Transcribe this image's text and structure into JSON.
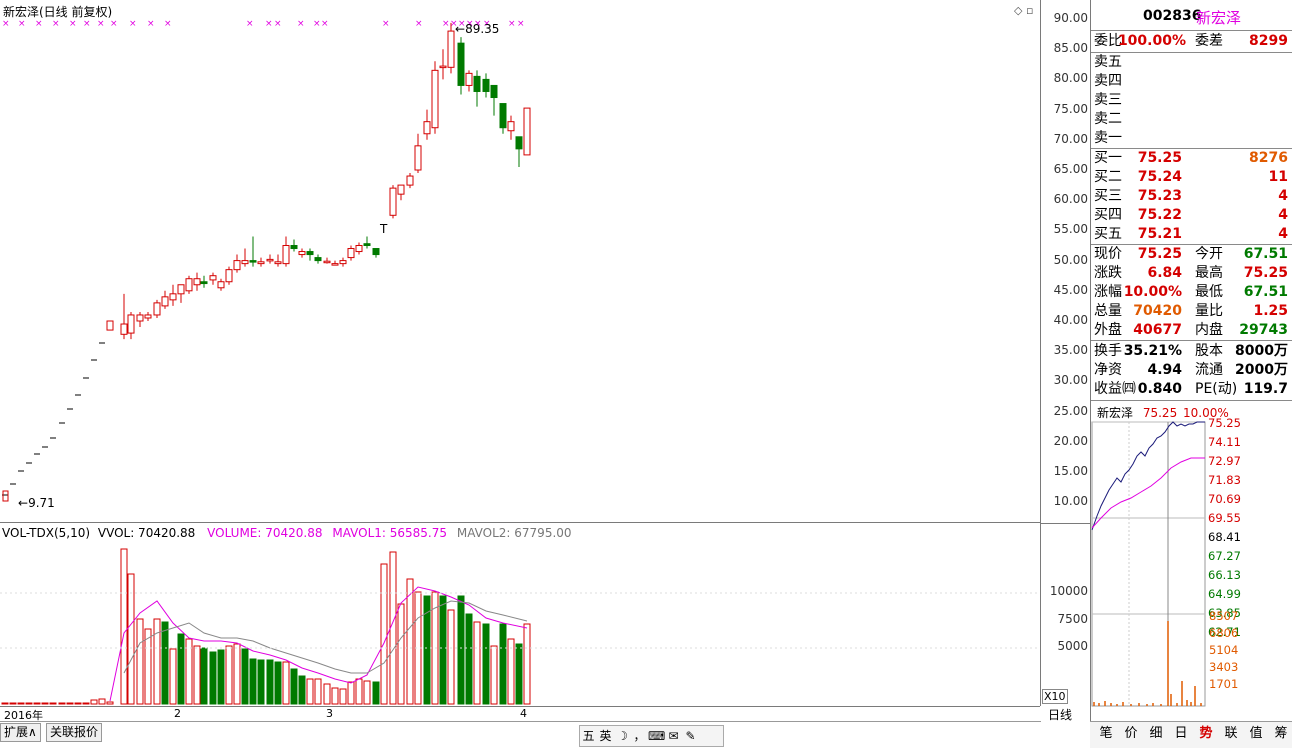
{
  "stock": {
    "code": "002836",
    "name": "新宏泽",
    "title": "新宏泽(日线 前复权)",
    "max_label": "89.35",
    "min_label": "9.71",
    "t_marker": "T",
    "year_label": "2016年"
  },
  "colors": {
    "up": "#d40000",
    "down": "#007a00",
    "ma": "#e000e0",
    "ma2": "#777777",
    "accent": "#2a2a9a"
  },
  "price_axis": [
    "90.00",
    "85.00",
    "80.00",
    "75.00",
    "70.00",
    "65.00",
    "60.00",
    "55.00",
    "50.00",
    "45.00",
    "40.00",
    "35.00",
    "30.00",
    "25.00",
    "20.00",
    "15.00",
    "10.00"
  ],
  "volume_axis": [
    "10000",
    "7500",
    "5000"
  ],
  "x_multiplier": "X10",
  "x_month_labels": [
    "2",
    "3",
    "4"
  ],
  "vol_header": {
    "name": "VOL-TDX(5,10)",
    "vvol": "VVOL: 70420.88",
    "volume": "VOLUME: 70420.88",
    "mavol1": "MAVOL1: 56585.75",
    "mavol2": "MAVOL2: 67795.00"
  },
  "quote": {
    "weibi_label": "委比",
    "weibi": "100.00%",
    "weicha_label": "委差",
    "weicha": "8299",
    "sell": [
      {
        "label": "卖五",
        "price": "",
        "vol": ""
      },
      {
        "label": "卖四",
        "price": "",
        "vol": ""
      },
      {
        "label": "卖三",
        "price": "",
        "vol": ""
      },
      {
        "label": "卖二",
        "price": "",
        "vol": ""
      },
      {
        "label": "卖一",
        "price": "",
        "vol": ""
      }
    ],
    "buy": [
      {
        "label": "买一",
        "price": "75.25",
        "vol": "8276"
      },
      {
        "label": "买二",
        "price": "75.24",
        "vol": "11"
      },
      {
        "label": "买三",
        "price": "75.23",
        "vol": "4"
      },
      {
        "label": "买四",
        "price": "75.22",
        "vol": "4"
      },
      {
        "label": "买五",
        "price": "75.21",
        "vol": "4"
      }
    ],
    "stats": [
      {
        "l1": "现价",
        "v1": "75.25",
        "c1": "red",
        "l2": "今开",
        "v2": "67.51",
        "c2": "green"
      },
      {
        "l1": "涨跌",
        "v1": "6.84",
        "c1": "red",
        "l2": "最高",
        "v2": "75.25",
        "c2": "red"
      },
      {
        "l1": "涨幅",
        "v1": "10.00%",
        "c1": "red",
        "l2": "最低",
        "v2": "67.51",
        "c2": "green"
      },
      {
        "l1": "总量",
        "v1": "70420",
        "c1": "orange",
        "l2": "量比",
        "v2": "1.25",
        "c2": "red"
      },
      {
        "l1": "外盘",
        "v1": "40677",
        "c1": "red",
        "l2": "内盘",
        "v2": "29743",
        "c2": "green"
      }
    ],
    "fund": [
      {
        "l1": "换手",
        "v1": "35.21%",
        "l2": "股本",
        "v2": "8000万"
      },
      {
        "l1": "净资",
        "v1": "4.94",
        "l2": "流通",
        "v2": "2000万"
      },
      {
        "l1": "收益㈣",
        "v1": "0.840",
        "l2": "PE(动)",
        "v2": "119.7"
      }
    ]
  },
  "mini": {
    "name": "新宏泽",
    "price": "75.25",
    "pct": "10.00%",
    "price_ticks": [
      "75.25",
      "74.11",
      "72.97",
      "71.83",
      "70.69",
      "69.55",
      "68.41",
      "67.27",
      "66.13",
      "64.99",
      "63.85",
      "62.71"
    ],
    "vol_ticks": [
      "8507",
      "6806",
      "5104",
      "3403",
      "1701"
    ]
  },
  "bottom": {
    "tab1": "扩展∧",
    "tab2": "关联报价",
    "period": "日线",
    "toolbar": [
      "五",
      "英",
      "☽",
      "，",
      "⌨",
      "✉",
      "✎"
    ],
    "right_tabs": [
      "笔",
      "价",
      "细",
      "日",
      "势",
      "联",
      "值",
      "筹"
    ]
  }
}
